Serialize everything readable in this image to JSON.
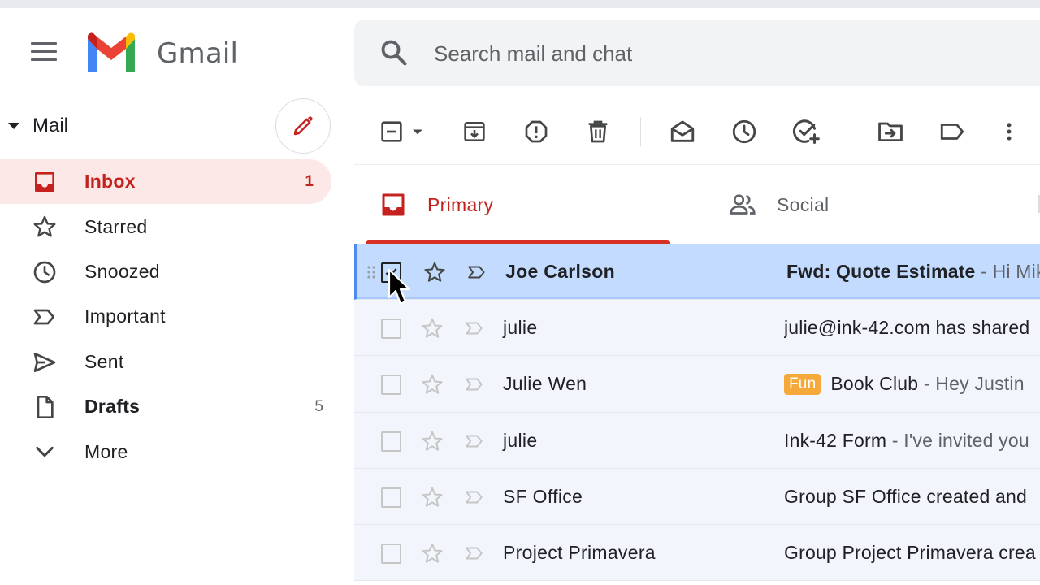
{
  "app": {
    "name": "Gmail"
  },
  "search": {
    "placeholder": "Search mail and chat"
  },
  "sidebar": {
    "section_label": "Mail",
    "compose_icon": "pencil-icon",
    "items": [
      {
        "label": "Inbox",
        "count": "1",
        "icon": "inbox-icon",
        "active": true
      },
      {
        "label": "Starred",
        "count": "",
        "icon": "star-icon"
      },
      {
        "label": "Snoozed",
        "count": "",
        "icon": "clock-icon"
      },
      {
        "label": "Important",
        "count": "",
        "icon": "important-icon"
      },
      {
        "label": "Sent",
        "count": "",
        "icon": "send-icon"
      },
      {
        "label": "Drafts",
        "count": "5",
        "icon": "draft-icon"
      },
      {
        "label": "More",
        "count": "",
        "icon": "chevron-down-icon"
      }
    ]
  },
  "toolbar": {
    "icons": [
      "select-checkbox-icon",
      "dropdown-arrow-icon",
      "archive-icon",
      "report-spam-icon",
      "delete-icon",
      "mark-as-read-icon",
      "snooze-icon",
      "add-to-tasks-icon",
      "move-to-icon",
      "label-icon",
      "more-vert-icon"
    ]
  },
  "tabs": [
    {
      "label": "Primary",
      "icon": "inbox-icon",
      "active": true
    },
    {
      "label": "Social",
      "icon": "people-icon"
    }
  ],
  "emails": [
    {
      "sender": "Joe Carlson",
      "label": "",
      "subject": "Fwd: Quote Estimate",
      "preview": " - Hi Mik",
      "selected": true
    },
    {
      "sender": "julie",
      "label": "",
      "subject": "julie@ink-42.com has shared",
      "preview": ""
    },
    {
      "sender": "Julie Wen",
      "label": "Fun",
      "subject": "Book Club",
      "preview": " - Hey Justin"
    },
    {
      "sender": "julie",
      "label": "",
      "subject": "Ink-42 Form",
      "preview": " - I've invited you"
    },
    {
      "sender": "SF Office",
      "label": "",
      "subject": "Group SF Office created and",
      "preview": ""
    },
    {
      "sender": "Project Primavera",
      "label": "",
      "subject": "Group Project Primavera crea",
      "preview": ""
    }
  ],
  "colors": {
    "gmail_red": "#d93025",
    "inbox_active_bg": "#fce8e6",
    "selected_row_bg": "#c2dbff",
    "read_row_bg": "#f2f6fc",
    "label_fun": "#f6a93b"
  }
}
